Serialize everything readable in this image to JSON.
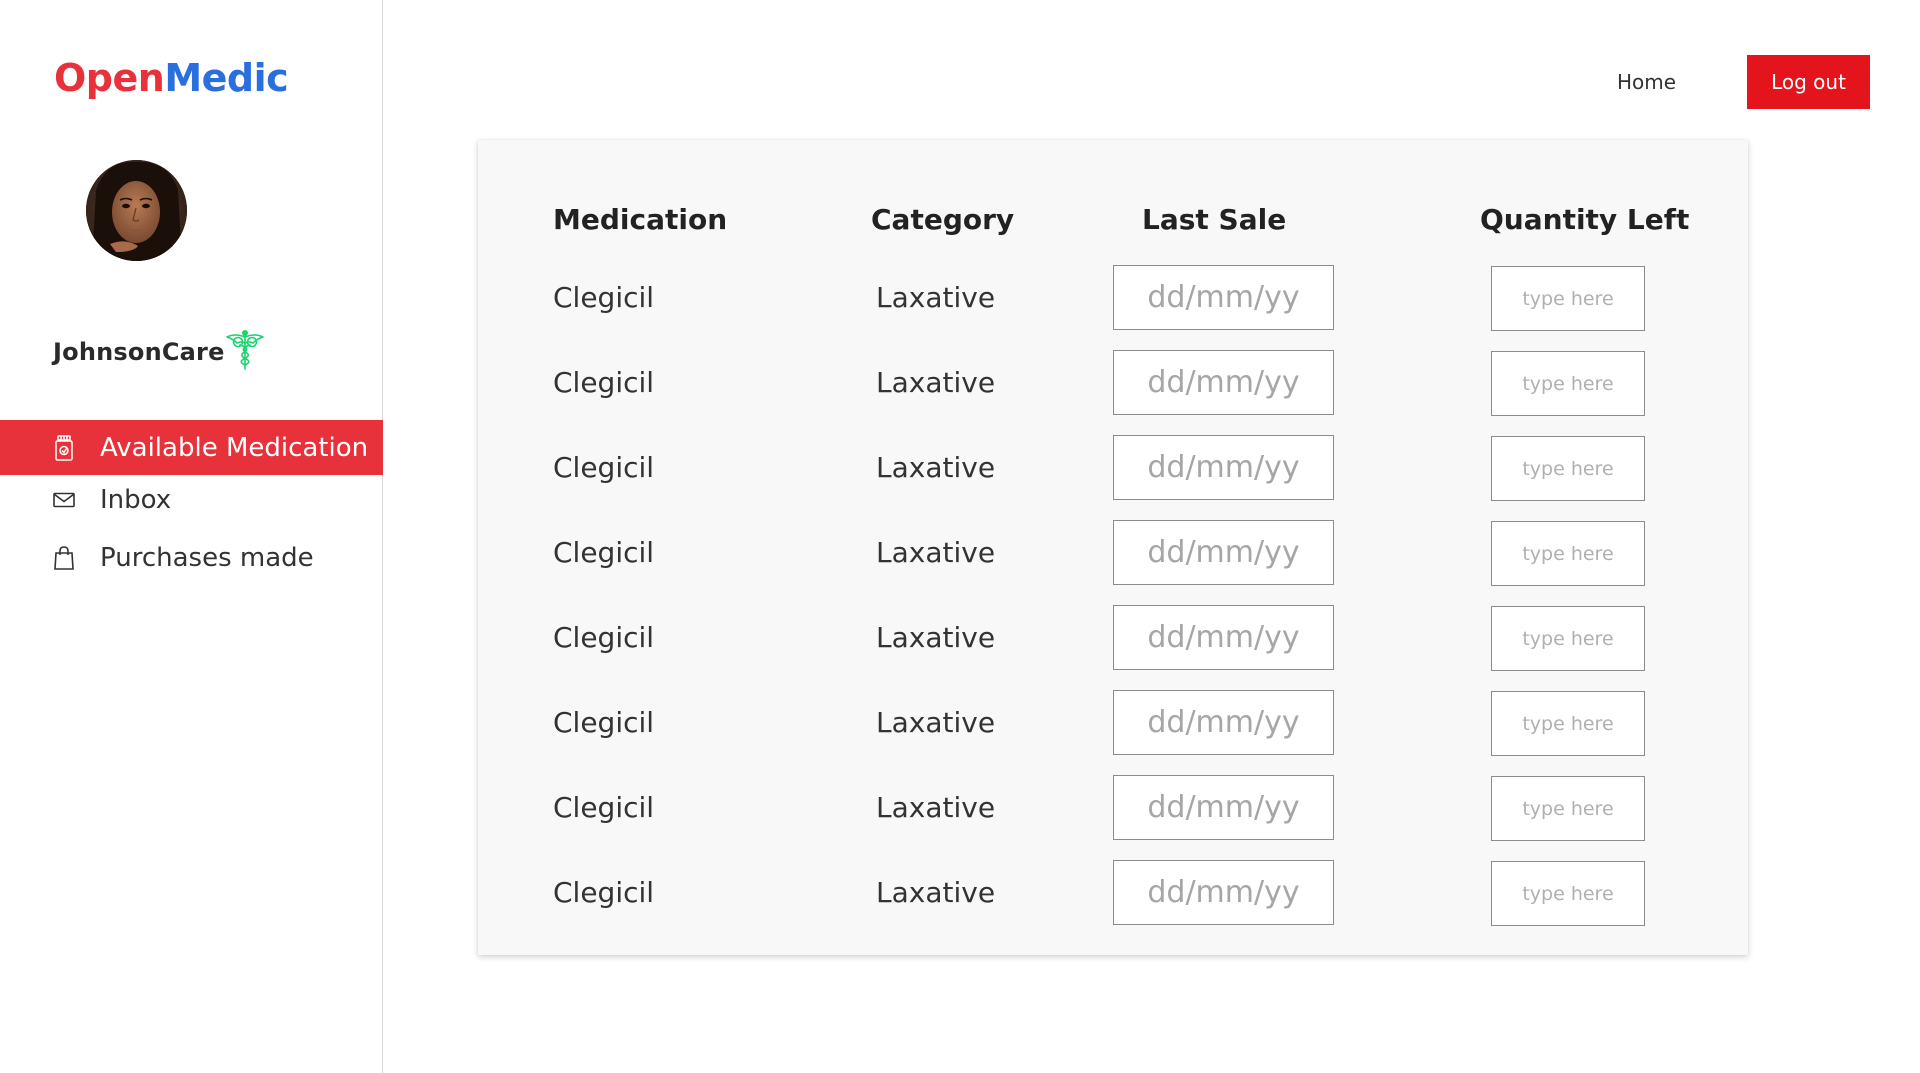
{
  "brand": {
    "part1": "Open",
    "part2": "Medic"
  },
  "org": {
    "name": "JohnsonCare"
  },
  "nav": {
    "items": [
      {
        "label": "Available Medication",
        "icon": "medicine-bottle-icon",
        "active": true
      },
      {
        "label": "Inbox",
        "icon": "envelope-icon",
        "active": false
      },
      {
        "label": "Purchases made",
        "icon": "shopping-bag-icon",
        "active": false
      }
    ]
  },
  "header": {
    "home": "Home",
    "logout": "Log out"
  },
  "table": {
    "headers": {
      "medication": "Medication",
      "category": "Category",
      "last_sale": "Last Sale",
      "quantity_left": "Quantity Left"
    },
    "rows": [
      {
        "medication": "Clegicil",
        "category": "Laxative",
        "last_sale_placeholder": "dd/mm/yy",
        "quantity_placeholder": "type here"
      },
      {
        "medication": "Clegicil",
        "category": "Laxative",
        "last_sale_placeholder": "dd/mm/yy",
        "quantity_placeholder": "type here"
      },
      {
        "medication": "Clegicil",
        "category": "Laxative",
        "last_sale_placeholder": "dd/mm/yy",
        "quantity_placeholder": "type here"
      },
      {
        "medication": "Clegicil",
        "category": "Laxative",
        "last_sale_placeholder": "dd/mm/yy",
        "quantity_placeholder": "type here"
      },
      {
        "medication": "Clegicil",
        "category": "Laxative",
        "last_sale_placeholder": "dd/mm/yy",
        "quantity_placeholder": "type here"
      },
      {
        "medication": "Clegicil",
        "category": "Laxative",
        "last_sale_placeholder": "dd/mm/yy",
        "quantity_placeholder": "type here"
      },
      {
        "medication": "Clegicil",
        "category": "Laxative",
        "last_sale_placeholder": "dd/mm/yy",
        "quantity_placeholder": "type here"
      },
      {
        "medication": "Clegicil",
        "category": "Laxative",
        "last_sale_placeholder": "dd/mm/yy",
        "quantity_placeholder": "type here"
      }
    ]
  },
  "colors": {
    "brand_red": "#e8313a",
    "brand_blue": "#2a6fe0",
    "active_nav": "#e8323b",
    "logout": "#e4141c",
    "emblem_green": "#19d46a"
  }
}
